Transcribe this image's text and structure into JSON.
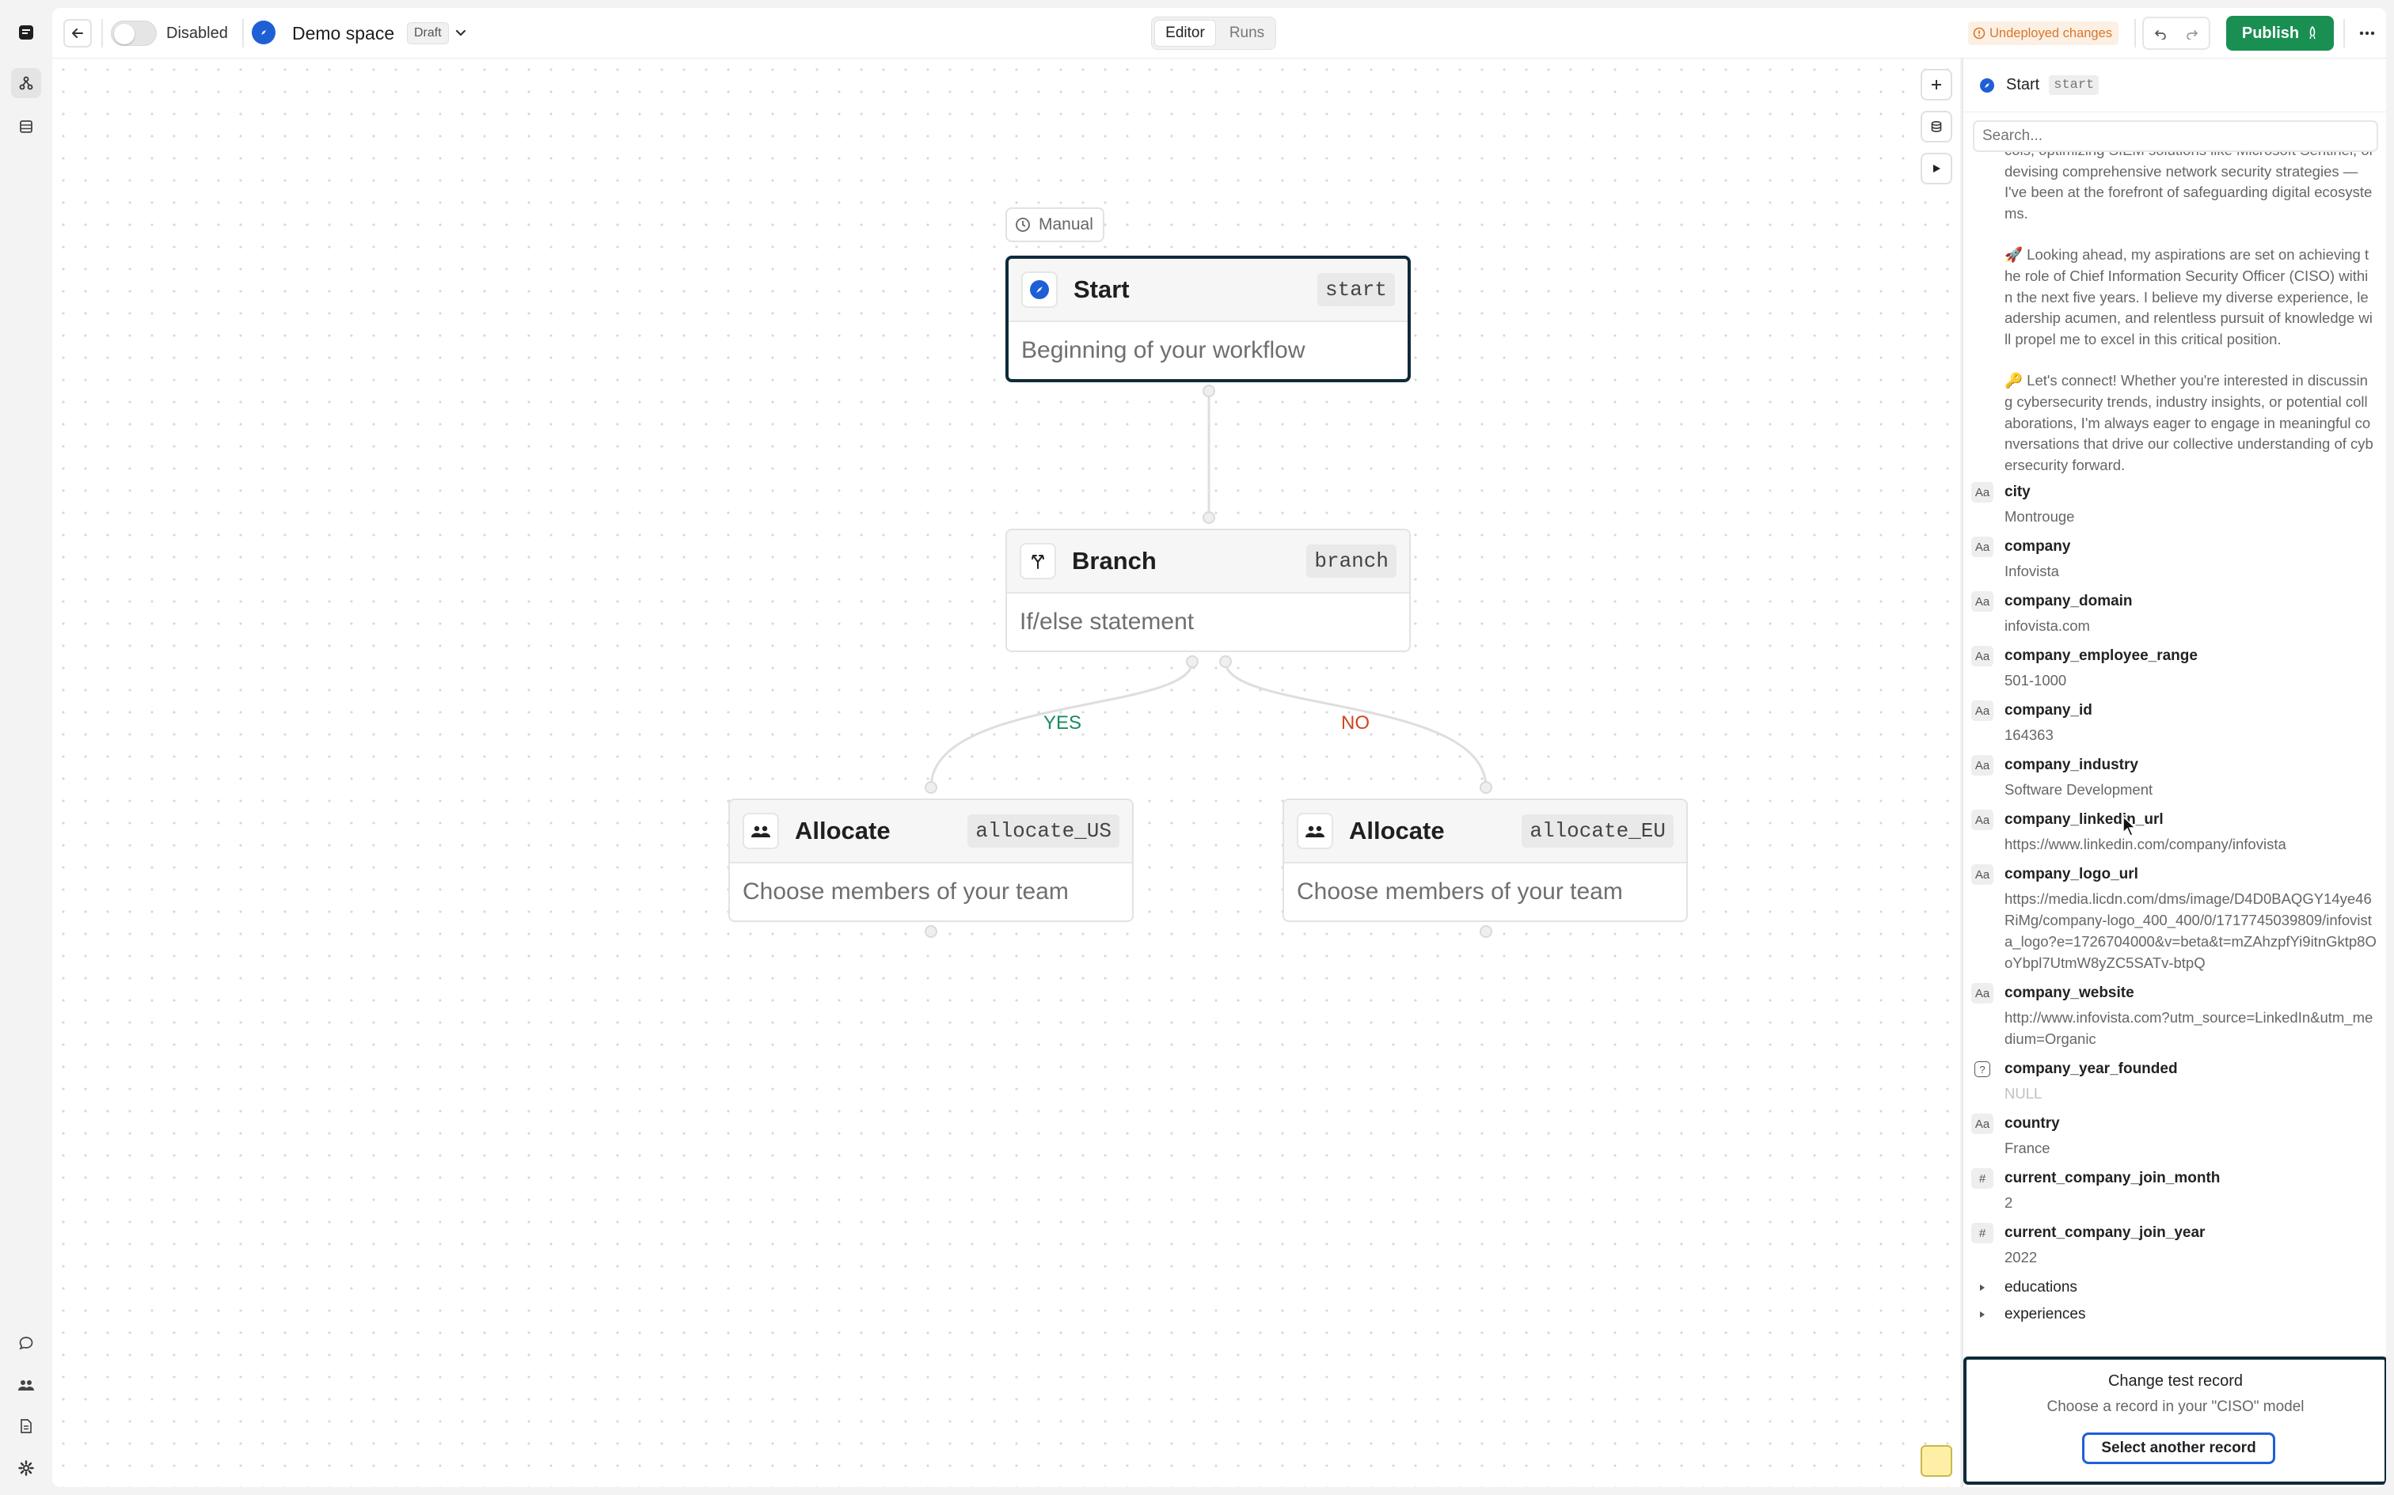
{
  "topbar": {
    "toggle_label": "Disabled",
    "space_name": "Demo space",
    "draft_badge": "Draft",
    "tabs": [
      {
        "label": "Editor",
        "active": true
      },
      {
        "label": "Runs",
        "active": false
      }
    ],
    "undeployed_label": "Undeployed changes",
    "publish_label": "Publish"
  },
  "canvas": {
    "trigger_label": "Manual",
    "nodes": {
      "start": {
        "title": "Start",
        "code": "start",
        "description": "Beginning of your workflow"
      },
      "branch": {
        "title": "Branch",
        "code": "branch",
        "description": "If/else statement"
      },
      "allocate_us": {
        "title": "Allocate",
        "code": "allocate_US",
        "description": "Choose members of your team"
      },
      "allocate_eu": {
        "title": "Allocate",
        "code": "allocate_EU",
        "description": "Choose members of your team"
      }
    },
    "edges": {
      "yes_label": "YES",
      "no_label": "NO"
    }
  },
  "panel": {
    "header_title": "Start",
    "header_code": "start",
    "search_placeholder": "Search...",
    "about_paragraphs": [
      "cols, optimizing SIEM solutions like Microsoft Sentinel, or devising comprehensive network security strategies — I've been at the forefront of safeguarding digital ecosystems.",
      "🚀 Looking ahead, my aspirations are set on achieving the role of Chief Information Security Officer (CISO) within the next five years. I believe my diverse experience, leadership acumen, and relentless pursuit of knowledge will propel me to excel in this critical position.",
      "🔑 Let's connect! Whether you're interested in discussing cybersecurity trends, industry insights, or potential collaborations, I'm always eager to engage in meaningful conversations that drive our collective understanding of cybersecurity forward."
    ],
    "fields": [
      {
        "type": "Aa",
        "name": "city",
        "value": "Montrouge"
      },
      {
        "type": "Aa",
        "name": "company",
        "value": "Infovista"
      },
      {
        "type": "Aa",
        "name": "company_domain",
        "value": "infovista.com"
      },
      {
        "type": "Aa",
        "name": "company_employee_range",
        "value": "501-1000"
      },
      {
        "type": "Aa",
        "name": "company_id",
        "value": "164363"
      },
      {
        "type": "Aa",
        "name": "company_industry",
        "value": "Software Development"
      },
      {
        "type": "Aa",
        "name": "company_linkedin_url",
        "value": "https://www.linkedin.com/company/infovista"
      },
      {
        "type": "Aa",
        "name": "company_logo_url",
        "value": "https://media.licdn.com/dms/image/D4D0BAQGY14ye46RiMg/company-logo_400_400/0/1717745039809/infovista_logo?e=1726704000&v=beta&t=mZAhzpfYi9itnGktp8OoYbpl7UtmW8yZC5SATv-btpQ"
      },
      {
        "type": "Aa",
        "name": "company_website",
        "value": "http://www.infovista.com?utm_source=LinkedIn&utm_medium=Organic"
      },
      {
        "type": "?",
        "name": "company_year_founded",
        "value": "NULL"
      },
      {
        "type": "Aa",
        "name": "country",
        "value": "France"
      },
      {
        "type": "#",
        "name": "current_company_join_month",
        "value": "2"
      },
      {
        "type": "#",
        "name": "current_company_join_year",
        "value": "2022"
      }
    ],
    "collapsed_fields": [
      "educations",
      "experiences"
    ],
    "test_record": {
      "title": "Change test record",
      "subtitle": "Choose a record in your \"CISO\" model",
      "button_label": "Select another record"
    }
  },
  "colors": {
    "accent_green": "#1a8f52",
    "warning_orange": "#d9762b",
    "selected_border": "#0e2a3a",
    "yes_green": "#1a8a5c",
    "no_red": "#d2461e"
  }
}
